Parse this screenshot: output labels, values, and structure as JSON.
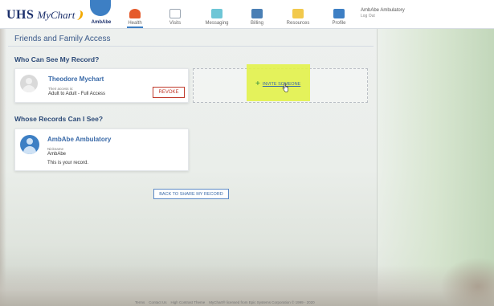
{
  "header": {
    "logo_text": "UHS",
    "logo_subtext": "MyChart",
    "avatar_label": "AmbAbe",
    "nav": [
      {
        "label": "Health",
        "icon": "health-icon",
        "color": "#e55a2b"
      },
      {
        "label": "Visits",
        "icon": "calendar-icon",
        "color": "#9aa5b1"
      },
      {
        "label": "Messaging",
        "icon": "envelope-icon",
        "color": "#6ec6d6"
      },
      {
        "label": "Billing",
        "icon": "card-icon",
        "color": "#4a7fb5"
      },
      {
        "label": "Resources",
        "icon": "folder-icon",
        "color": "#f2c94c"
      },
      {
        "label": "Profile",
        "icon": "id-card-icon",
        "color": "#3d7fc4"
      }
    ],
    "user_name": "AmbAbe Ambulatory",
    "logout": "Log Out"
  },
  "page": {
    "title": "Friends and Family Access",
    "section_who_can_see": "Who Can See My Record?",
    "section_whose_records": "Whose Records Can I See?"
  },
  "proxy_card": {
    "name": "Theodore Mychart",
    "access_caption": "Their access is:",
    "access_level": "Adult to Adult - Full Access",
    "revoke_label": "REVOKE"
  },
  "invite": {
    "label": "INVITE SOMEONE",
    "highlight_color": "#e2f24a"
  },
  "own_card": {
    "name": "AmbAbe Ambulatory",
    "nickname_caption": "Nickname",
    "nickname": "AmbAbe",
    "note": "This is your record."
  },
  "back_button": "BACK TO SHARE MY RECORD",
  "footer": {
    "links": [
      "Terms",
      "Contact Us",
      "High Contrast Theme"
    ],
    "copyright": "MyChart® licensed from Epic Systems Corporation © 1999 - 2020"
  }
}
